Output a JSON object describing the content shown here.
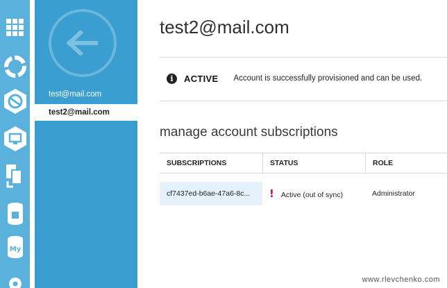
{
  "colors": {
    "rail": "#59b1dc",
    "panel": "#3a9ed0",
    "warning": "#c0114a",
    "selected_row": "#e6f2fb"
  },
  "rail_icons": [
    "grid-icon",
    "refresh-icon",
    "globe-icon",
    "monitor-icon",
    "database-transfer-icon",
    "sql-database-icon",
    "mysql-database-icon",
    "settings-icon"
  ],
  "accounts": {
    "items": [
      {
        "label": "test@mail.com"
      },
      {
        "label": "test2@mail.com"
      }
    ]
  },
  "main": {
    "title": "test2@mail.com",
    "status": {
      "state": "ACTIVE",
      "message": "Account is successfully provisioned and can be used."
    },
    "section_title": "manage account subscriptions",
    "table": {
      "headers": [
        "SUBSCRIPTIONS",
        "STATUS",
        "ROLE"
      ],
      "rows": [
        {
          "subscription": "cf7437ed-b6ae-47a6-8c...",
          "status": "Active (out of sync)",
          "role": "Administrator"
        }
      ]
    }
  },
  "watermark": "www.rlevchenko.com"
}
